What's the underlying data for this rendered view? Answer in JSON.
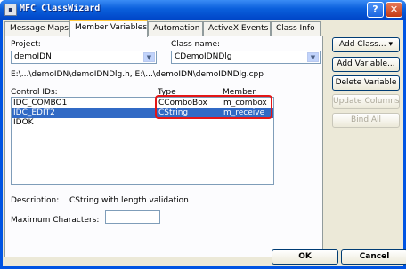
{
  "window": {
    "title": "MFC ClassWizard",
    "help": "?",
    "close": "✕"
  },
  "tabs": [
    {
      "label": "Message Maps",
      "active": false
    },
    {
      "label": "Member Variables",
      "active": true
    },
    {
      "label": "Automation",
      "active": false
    },
    {
      "label": "ActiveX Events",
      "active": false
    },
    {
      "label": "Class Info",
      "active": false
    }
  ],
  "project": {
    "label": "Project:",
    "value": "demoIDN"
  },
  "class_name": {
    "label": "Class name:",
    "value": "CDemoIDNDlg"
  },
  "file_path": "E:\\...\\demoIDN\\demoIDNDlg.h, E:\\...\\demoIDN\\demoIDNDlg.cpp",
  "list": {
    "headers": {
      "ids": "Control IDs:",
      "type": "Type",
      "member": "Member"
    },
    "rows": [
      {
        "id": "IDC_COMBO1",
        "type": "CComboBox",
        "member": "m_combox",
        "selected": false
      },
      {
        "id": "IDC_EDIT2",
        "type": "CString",
        "member": "m_receive",
        "selected": true
      },
      {
        "id": "IDOK",
        "type": "",
        "member": "",
        "selected": false
      }
    ]
  },
  "description": {
    "label": "Description:",
    "value": "CString with length validation"
  },
  "max_chars": {
    "label": "Maximum Characters:",
    "value": ""
  },
  "buttons": {
    "add_class": "Add Class...",
    "add_variable": "Add Variable...",
    "delete_variable": "Delete Variable",
    "update_columns": "Update Columns",
    "bind_all": "Bind All",
    "ok": "OK",
    "cancel": "Cancel"
  }
}
